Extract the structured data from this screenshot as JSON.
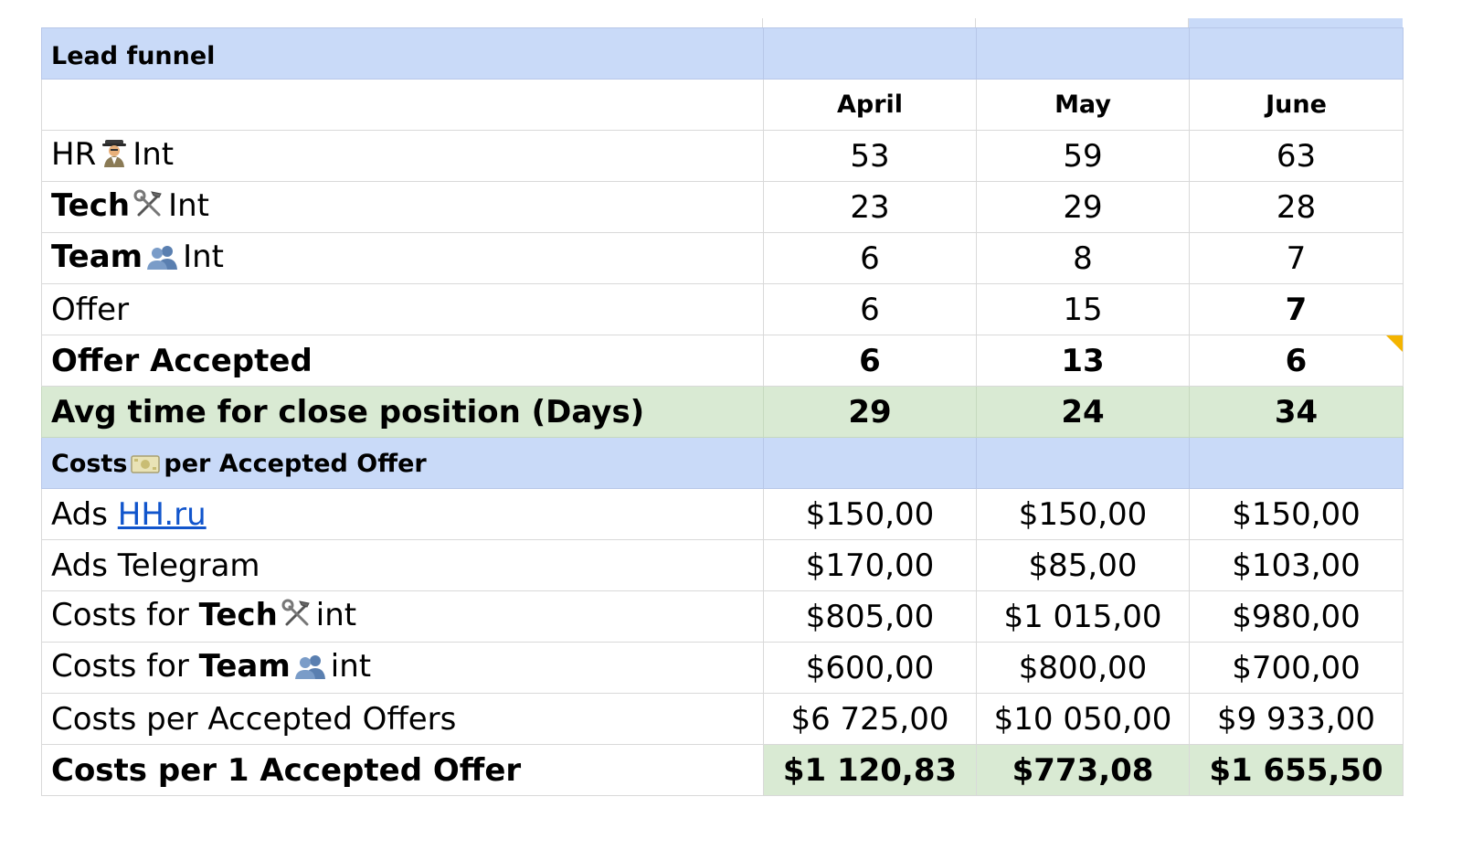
{
  "sections": {
    "lead_funnel": "Lead funnel",
    "costs_prefix": "Costs",
    "costs_suffix": "per Accepted Offer",
    "costs_icon": "money-banknote-icon"
  },
  "months": [
    "April",
    "May",
    "June"
  ],
  "funnel_rows": [
    {
      "label_a": "HR",
      "icon": "detective-icon",
      "label_b": "Int",
      "values": [
        "53",
        "59",
        "63"
      ]
    },
    {
      "label_a": "Tech",
      "icon": "hammer-wrench-icon",
      "label_b": "Int",
      "values": [
        "23",
        "29",
        "28"
      ]
    },
    {
      "label_a": "Team",
      "icon": "people-icon",
      "label_b": "Int",
      "values": [
        "6",
        "8",
        "7"
      ]
    },
    {
      "label": "Offer",
      "values": [
        "6",
        "15",
        "7"
      ]
    },
    {
      "label": "Offer Accepted",
      "values": [
        "6",
        "13",
        "6"
      ]
    },
    {
      "label": "Avg time for close position (Days)",
      "values": [
        "29",
        "24",
        "34"
      ]
    }
  ],
  "cost_rows": [
    {
      "label_a": "Ads",
      "link": "HH.ru",
      "values": [
        "$150,00",
        "$150,00",
        "$150,00"
      ]
    },
    {
      "label": "Ads Telegram",
      "values": [
        "$170,00",
        "$85,00",
        "$103,00"
      ]
    },
    {
      "label_a": "Costs for",
      "label_bold": "Tech",
      "icon": "hammer-wrench-icon",
      "label_b": "int",
      "values": [
        "$805,00",
        "$1 015,00",
        "$980,00"
      ]
    },
    {
      "label_a": "Costs for",
      "label_bold": "Team",
      "icon": "people-icon",
      "label_b": "int",
      "values": [
        "$600,00",
        "$800,00",
        "$700,00"
      ]
    },
    {
      "label": "Costs per Accepted Offers",
      "values": [
        "$6 725,00",
        "$10 050,00",
        "$9 933,00"
      ]
    },
    {
      "label": "Costs per 1 Accepted Offer",
      "values": [
        "$1 120,83",
        "$773,08",
        "$1 655,50"
      ]
    }
  ],
  "colors": {
    "section_blue": "#c9daf8",
    "highlight_green": "#d9ead3",
    "link_blue": "#1155cc",
    "note_marker": "#f4b400"
  }
}
